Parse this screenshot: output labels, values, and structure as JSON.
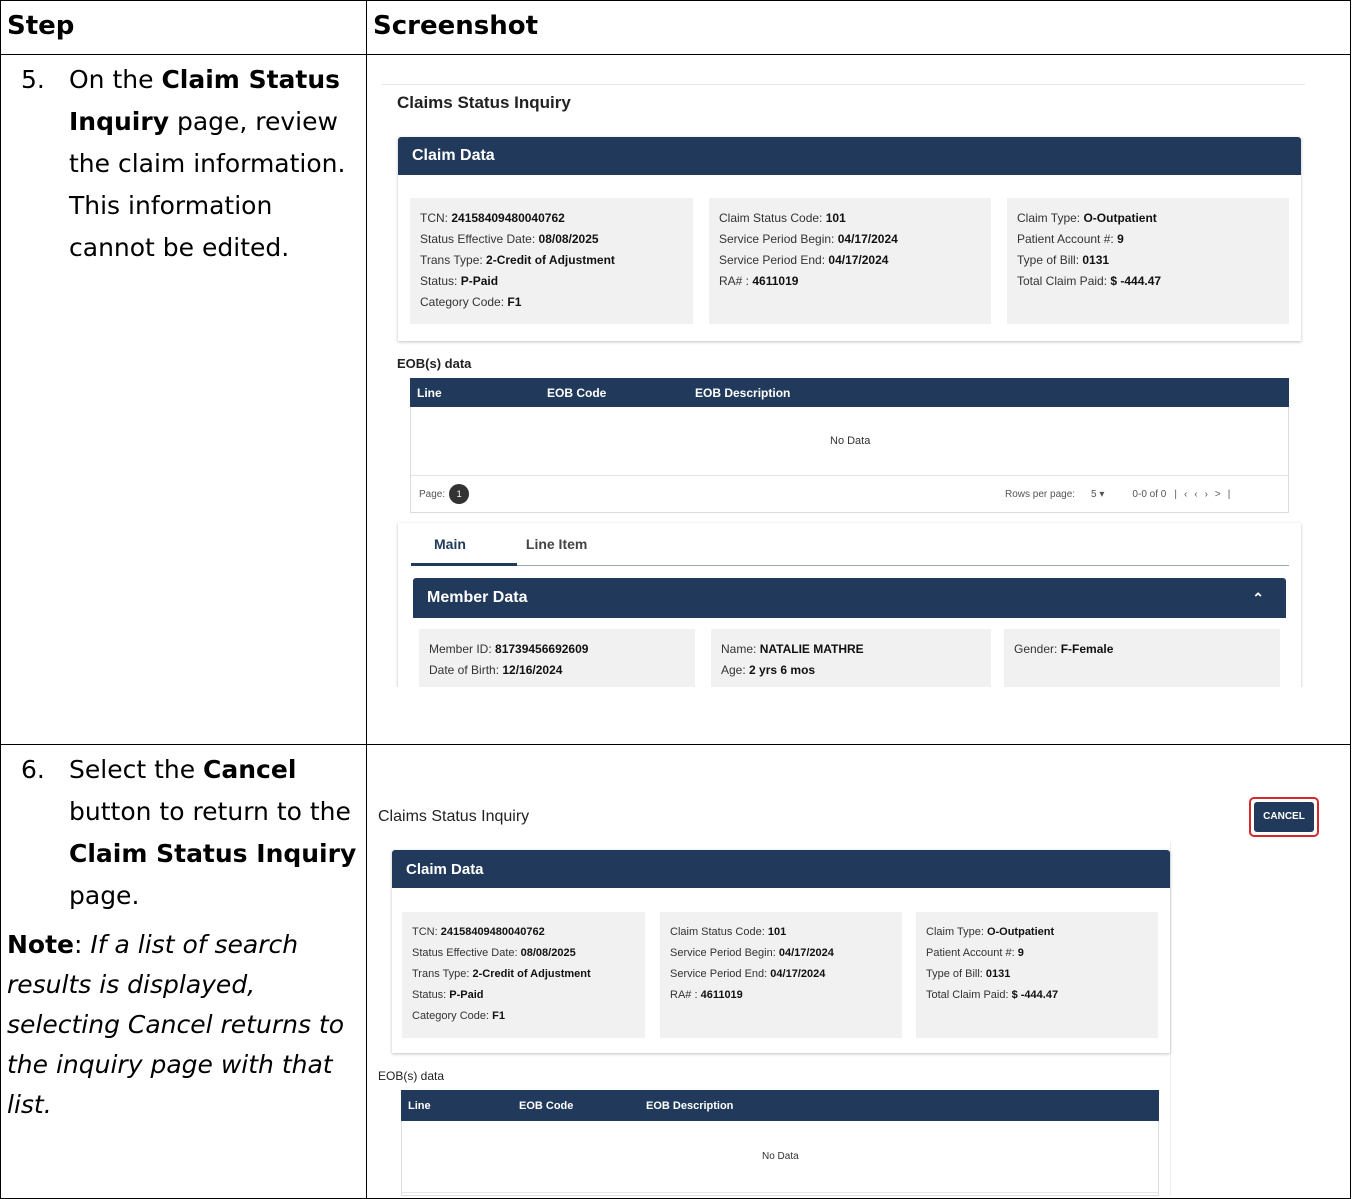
{
  "table": {
    "header_step": "Step",
    "header_screenshot": "Screenshot"
  },
  "step5": {
    "number": "5.",
    "text_parts": [
      "On the ",
      "Claim Status Inquiry",
      " page, review the claim information. This information cannot be edited."
    ]
  },
  "step6": {
    "number": "6.",
    "text_parts": [
      "Select the ",
      "Cancel",
      " button to return to the ",
      "Claim Status Inquiry",
      " page."
    ],
    "note_label": "Note",
    "note_text": "If a list of search results is displayed, selecting Cancel returns to the inquiry page with that list."
  },
  "shot1": {
    "page_title": "Claims Status Inquiry",
    "claim_data_title": "Claim Data",
    "col1": [
      {
        "label": "TCN: ",
        "value": "24158409480040762"
      },
      {
        "label": "Status Effective Date: ",
        "value": "08/08/2025"
      },
      {
        "label": "Trans Type: ",
        "value": "2-Credit of Adjustment"
      },
      {
        "label": "Status: ",
        "value": "P-Paid"
      },
      {
        "label": "Category Code: ",
        "value": "F1"
      }
    ],
    "col2": [
      {
        "label": "Claim Status Code: ",
        "value": "101"
      },
      {
        "label": "Service Period Begin: ",
        "value": "04/17/2024"
      },
      {
        "label": "Service Period End: ",
        "value": "04/17/2024"
      },
      {
        "label": "RA# : ",
        "value": "4611019"
      }
    ],
    "col3": [
      {
        "label": "Claim Type: ",
        "value": "O-Outpatient"
      },
      {
        "label": "Patient Account #: ",
        "value": "9"
      },
      {
        "label": "Type of Bill: ",
        "value": "0131"
      },
      {
        "label": "Total Claim Paid: ",
        "value": "$ -444.47"
      }
    ],
    "eob_label": "EOB(s) data",
    "eob_columns": [
      "Line",
      "EOB Code",
      "EOB Description"
    ],
    "no_data": "No Data",
    "page_label": "Page:",
    "page_number": "1",
    "rows_per_page_label": "Rows per page:",
    "rows_per_page_value": "5",
    "range_text": "0-0 of 0",
    "tabs": [
      "Main",
      "Line Item"
    ],
    "member_data_title": "Member Data",
    "member_col1": [
      {
        "label": "Member ID: ",
        "value": "81739456692609"
      },
      {
        "label": "Date of Birth: ",
        "value": "12/16/2024"
      }
    ],
    "member_col2": [
      {
        "label": "Name: ",
        "value": "NATALIE MATHRE"
      },
      {
        "label": "Age: ",
        "value": "2 yrs 6 mos"
      }
    ],
    "member_col3": [
      {
        "label": "Gender: ",
        "value": "F-Female"
      }
    ]
  },
  "shot2": {
    "page_title": "Claims Status Inquiry",
    "cancel_label": "CANCEL",
    "claim_data_title": "Claim Data",
    "eob_label": "EOB(s) data",
    "eob_columns": [
      "Line",
      "EOB Code",
      "EOB Description"
    ],
    "no_data": "No Data"
  }
}
